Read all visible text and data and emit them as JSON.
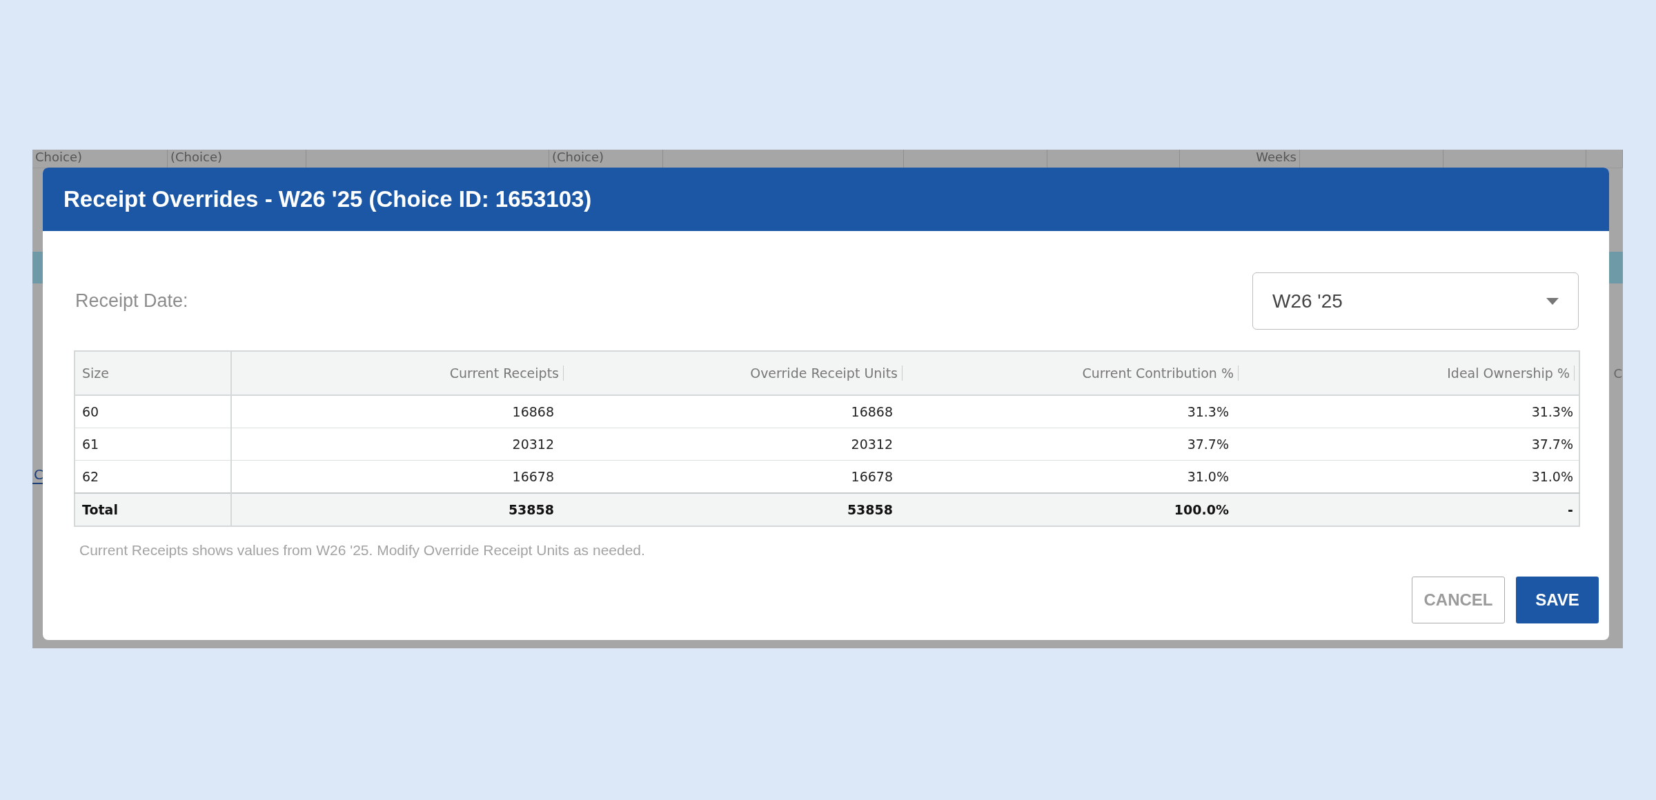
{
  "background": {
    "header_cells": [
      {
        "text": "Choice)"
      },
      {
        "text": "(Choice)"
      },
      {
        "text": "(Choice)"
      },
      {
        "text": "Weeks"
      }
    ],
    "left_tab": "C",
    "right_cell": "C"
  },
  "dialog": {
    "title": "Receipt Overrides - W26 '25 (Choice ID: 1653103)",
    "receipt_date_label": "Receipt Date:",
    "date_select": {
      "value": "W26 '25"
    },
    "table": {
      "columns": [
        "Size",
        "Current Receipts",
        "Override Receipt Units",
        "Current Contribution %",
        "Ideal Ownership %"
      ],
      "rows": [
        [
          "60",
          "16868",
          "16868",
          "31.3%",
          "31.3%"
        ],
        [
          "61",
          "20312",
          "20312",
          "37.7%",
          "37.7%"
        ],
        [
          "62",
          "16678",
          "16678",
          "31.0%",
          "31.0%"
        ]
      ],
      "total": [
        "Total",
        "53858",
        "53858",
        "100.0%",
        "-"
      ]
    },
    "footnote": "Current Receipts shows values from W26 '25. Modify Override Receipt Units as needed.",
    "buttons": [
      {
        "label": "CANCEL",
        "kind": "secondary"
      },
      {
        "label": "SAVE",
        "kind": "primary"
      }
    ]
  }
}
